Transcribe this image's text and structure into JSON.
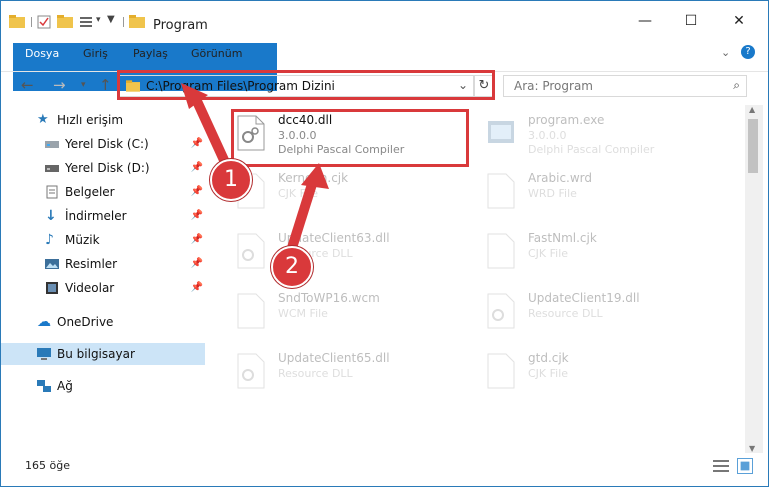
{
  "window": {
    "title": "Program"
  },
  "ribbon": {
    "tabs": [
      "Dosya",
      "Giriş",
      "Paylaş",
      "Görünüm"
    ]
  },
  "address": {
    "path": "C:\\Program Files\\Program Dizini"
  },
  "search": {
    "placeholder": "Ara: Program"
  },
  "sidebar": {
    "items": [
      {
        "label": "Hızlı erişim",
        "icon": "star-icon"
      },
      {
        "label": "Yerel Disk (C:)",
        "icon": "drive-icon"
      },
      {
        "label": "Yerel Disk (D:)",
        "icon": "drive-icon"
      },
      {
        "label": "Belgeler",
        "icon": "documents-icon"
      },
      {
        "label": "İndirmeler",
        "icon": "download-icon"
      },
      {
        "label": "Müzik",
        "icon": "music-icon"
      },
      {
        "label": "Resimler",
        "icon": "pictures-icon"
      },
      {
        "label": "Videolar",
        "icon": "video-icon"
      },
      {
        "label": "OneDrive",
        "icon": "cloud-icon"
      },
      {
        "label": "Bu bilgisayar",
        "icon": "computer-icon"
      },
      {
        "label": "Ağ",
        "icon": "network-icon"
      }
    ]
  },
  "files": [
    {
      "name": "dcc40.dll",
      "type": "3.0.0.0",
      "desc": "Delphi Pascal Compiler"
    },
    {
      "name": "program.exe",
      "type": "3.0.0.0",
      "desc": "Delphi Pascal Compiler"
    },
    {
      "name": "Kernelm.cjk",
      "type": "CJK File"
    },
    {
      "name": "Arabic.wrd",
      "type": "WRD File"
    },
    {
      "name": "UpdateClient63.dll",
      "type": "Resource DLL"
    },
    {
      "name": "FastNml.cjk",
      "type": "CJK File"
    },
    {
      "name": "SndToWP16.wcm",
      "type": "WCM File"
    },
    {
      "name": "UpdateClient19.dll",
      "type": "Resource DLL"
    },
    {
      "name": "UpdateClient65.dll",
      "type": "Resource DLL"
    },
    {
      "name": "gtd.cjk",
      "type": "CJK File"
    }
  ],
  "status": {
    "count": "165 öğe"
  },
  "annotations": [
    "1",
    "2"
  ],
  "colors": {
    "accent": "#1979ca",
    "highlight": "#d9393b",
    "selected": "#cce4f7"
  }
}
